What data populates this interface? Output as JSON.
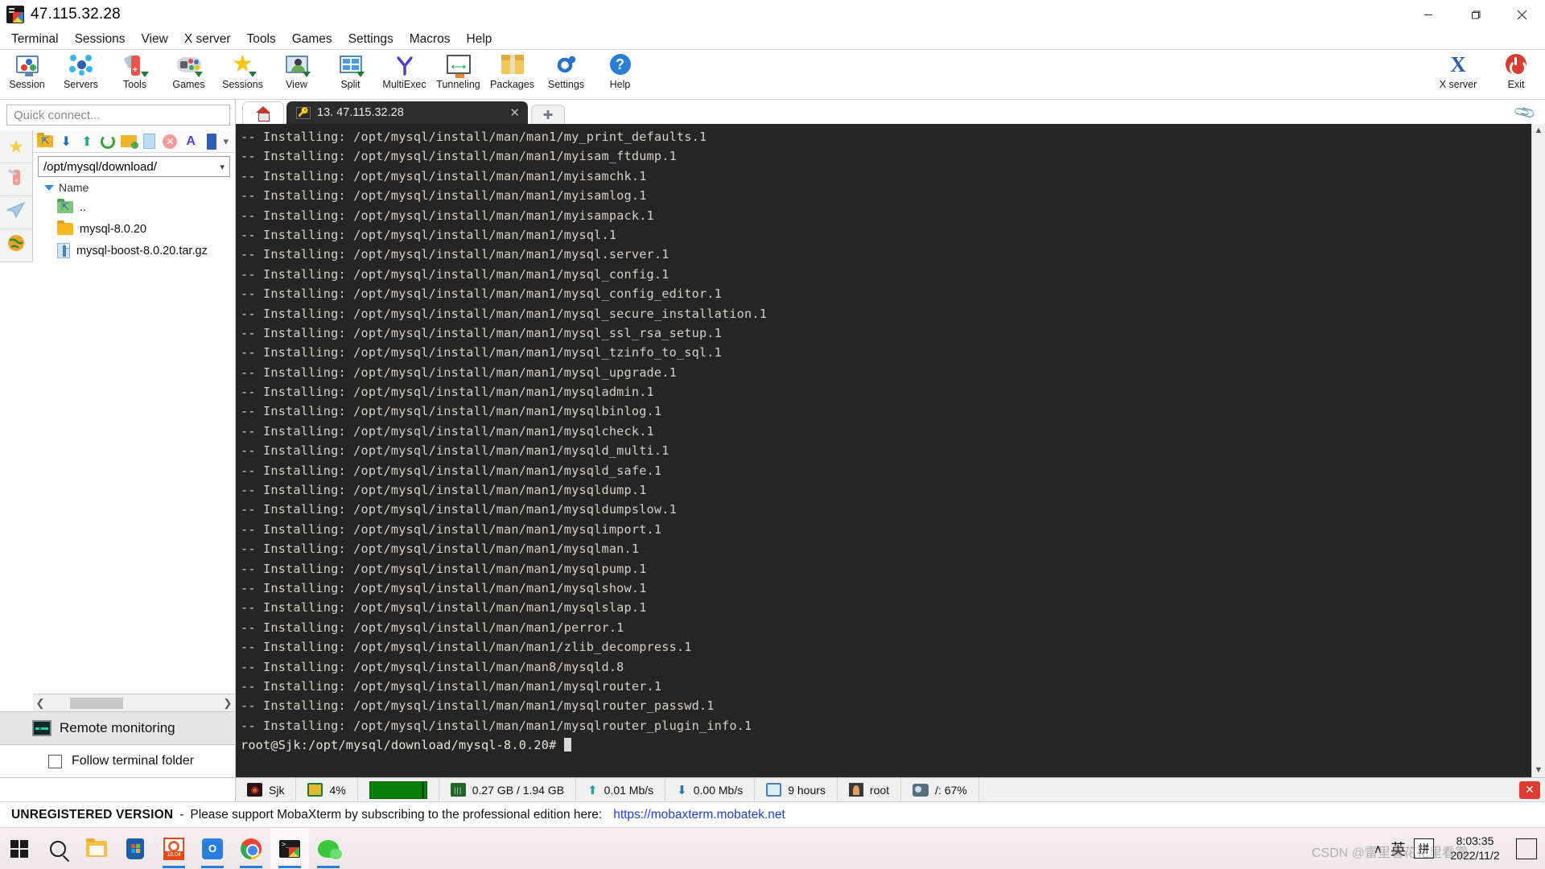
{
  "window": {
    "title": "47.115.32.28",
    "icon": "mobaxterm-logo-icon",
    "minimize": "─",
    "maximize": "❐",
    "close": "✕"
  },
  "menubar": {
    "items": [
      {
        "label": "Terminal"
      },
      {
        "label": "Sessions"
      },
      {
        "label": "View"
      },
      {
        "label": "X server"
      },
      {
        "label": "Tools"
      },
      {
        "label": "Games"
      },
      {
        "label": "Settings"
      },
      {
        "label": "Macros"
      },
      {
        "label": "Help"
      }
    ]
  },
  "toolbar": {
    "items": [
      {
        "label": "Session",
        "icon": "session-icon"
      },
      {
        "label": "Servers",
        "icon": "servers-icon"
      },
      {
        "label": "Tools",
        "icon": "tools-icon"
      },
      {
        "label": "Games",
        "icon": "games-icon"
      },
      {
        "label": "Sessions",
        "icon": "sessions-star-icon"
      },
      {
        "label": "View",
        "icon": "view-icon"
      },
      {
        "label": "Split",
        "icon": "split-icon"
      },
      {
        "label": "MultiExec",
        "icon": "multiexec-icon"
      },
      {
        "label": "Tunneling",
        "icon": "tunneling-icon"
      },
      {
        "label": "Packages",
        "icon": "packages-icon"
      },
      {
        "label": "Settings",
        "icon": "settings-gear-icon"
      },
      {
        "label": "Help",
        "icon": "help-icon"
      }
    ],
    "right_items": [
      {
        "label": "X server",
        "icon": "x-server-icon"
      },
      {
        "label": "Exit",
        "icon": "exit-power-icon"
      }
    ]
  },
  "sidebar": {
    "quick_connect_placeholder": "Quick connect...",
    "rail": [
      {
        "name": "bookmarks",
        "icon": "star-icon"
      },
      {
        "name": "tools",
        "icon": "swiss-knife-icon"
      },
      {
        "name": "sftp",
        "icon": "paper-plane-icon"
      },
      {
        "name": "macros",
        "icon": "globe-icon"
      }
    ],
    "browser_toolbar": [
      {
        "name": "parent-folder",
        "icon": "folder-up-icon"
      },
      {
        "name": "download",
        "icon": "download-arrow-icon"
      },
      {
        "name": "upload",
        "icon": "upload-arrow-icon"
      },
      {
        "name": "refresh",
        "icon": "refresh-icon"
      },
      {
        "name": "new-folder",
        "icon": "new-folder-icon"
      },
      {
        "name": "new-file",
        "icon": "new-file-icon"
      },
      {
        "name": "delete",
        "icon": "delete-x-icon"
      },
      {
        "name": "text-mode",
        "icon": "letter-a-icon"
      },
      {
        "name": "usb-mode",
        "icon": "usb-icon"
      }
    ],
    "path": "/opt/mysql/download/",
    "column_header": "Name",
    "files": [
      {
        "name": "..",
        "type": "parent-folder"
      },
      {
        "name": "mysql-8.0.20",
        "type": "folder"
      },
      {
        "name": "mysql-boost-8.0.20.tar.gz",
        "type": "file"
      }
    ],
    "remote_monitoring_label": "Remote monitoring",
    "follow_terminal_folder_label": "Follow terminal folder",
    "follow_terminal_folder_checked": false
  },
  "tabs": {
    "home_tab_icon": "home-icon",
    "active_tab_label": "13. 47.115.32.28",
    "active_tab_icon": "key-icon",
    "close_glyph": "✕",
    "add_tab_glyph": "➕",
    "clip_icon": "paperclip-icon"
  },
  "terminal": {
    "lines": [
      "-- Installing: /opt/mysql/install/man/man1/my_print_defaults.1",
      "-- Installing: /opt/mysql/install/man/man1/myisam_ftdump.1",
      "-- Installing: /opt/mysql/install/man/man1/myisamchk.1",
      "-- Installing: /opt/mysql/install/man/man1/myisamlog.1",
      "-- Installing: /opt/mysql/install/man/man1/myisampack.1",
      "-- Installing: /opt/mysql/install/man/man1/mysql.1",
      "-- Installing: /opt/mysql/install/man/man1/mysql.server.1",
      "-- Installing: /opt/mysql/install/man/man1/mysql_config.1",
      "-- Installing: /opt/mysql/install/man/man1/mysql_config_editor.1",
      "-- Installing: /opt/mysql/install/man/man1/mysql_secure_installation.1",
      "-- Installing: /opt/mysql/install/man/man1/mysql_ssl_rsa_setup.1",
      "-- Installing: /opt/mysql/install/man/man1/mysql_tzinfo_to_sql.1",
      "-- Installing: /opt/mysql/install/man/man1/mysql_upgrade.1",
      "-- Installing: /opt/mysql/install/man/man1/mysqladmin.1",
      "-- Installing: /opt/mysql/install/man/man1/mysqlbinlog.1",
      "-- Installing: /opt/mysql/install/man/man1/mysqlcheck.1",
      "-- Installing: /opt/mysql/install/man/man1/mysqld_multi.1",
      "-- Installing: /opt/mysql/install/man/man1/mysqld_safe.1",
      "-- Installing: /opt/mysql/install/man/man1/mysqldump.1",
      "-- Installing: /opt/mysql/install/man/man1/mysqldumpslow.1",
      "-- Installing: /opt/mysql/install/man/man1/mysqlimport.1",
      "-- Installing: /opt/mysql/install/man/man1/mysqlman.1",
      "-- Installing: /opt/mysql/install/man/man1/mysqlpump.1",
      "-- Installing: /opt/mysql/install/man/man1/mysqlshow.1",
      "-- Installing: /opt/mysql/install/man/man1/mysqlslap.1",
      "-- Installing: /opt/mysql/install/man/man1/perror.1",
      "-- Installing: /opt/mysql/install/man/man1/zlib_decompress.1",
      "-- Installing: /opt/mysql/install/man/man8/mysqld.8",
      "-- Installing: /opt/mysql/install/man/man1/mysqlrouter.1",
      "-- Installing: /opt/mysql/install/man/man1/mysqlrouter_passwd.1",
      "-- Installing: /opt/mysql/install/man/man1/mysqlrouter_plugin_info.1"
    ],
    "prompt": "root@Sjk:/opt/mysql/download/mysql-8.0.20# ",
    "bg_color": "#252525",
    "fg_color": "#d6d0c8"
  },
  "statusbar": {
    "cells": [
      {
        "icon": "ubuntu-icon",
        "label": "Sjk"
      },
      {
        "icon": "cpu-icon",
        "label": "4%"
      },
      {
        "icon": "memory-gauge",
        "label": ""
      },
      {
        "icon": "ram-icon",
        "label": "0.27 GB / 1.94 GB"
      },
      {
        "icon": "upload-icon",
        "label": "0.01 Mb/s"
      },
      {
        "icon": "download-icon",
        "label": "0.00 Mb/s"
      },
      {
        "icon": "clock-icon",
        "label": "9 hours"
      },
      {
        "icon": "user-icon",
        "label": "root"
      },
      {
        "icon": "disk-icon",
        "label": "/: 67%"
      }
    ],
    "close_glyph": "✕"
  },
  "banner": {
    "bold_text": "UNREGISTERED VERSION",
    "dash": "-",
    "message": "Please support MobaXterm by subscribing to the professional edition here:",
    "link": "https://mobaxterm.mobatek.net",
    "link_color": "#1f3fd6"
  },
  "taskbar": {
    "items": [
      {
        "name": "start-button",
        "icon": "windows-logo-icon"
      },
      {
        "name": "search",
        "icon": "search-icon"
      },
      {
        "name": "file-explorer",
        "icon": "folder-icon"
      },
      {
        "name": "microsoft-store",
        "icon": "store-icon"
      },
      {
        "name": "ubuntu-1804",
        "icon": "ubuntu-icon",
        "badge": "18.04"
      },
      {
        "name": "outlook",
        "icon": "outlook-icon"
      },
      {
        "name": "google-chrome",
        "icon": "chrome-icon"
      },
      {
        "name": "mobaxterm",
        "icon": "mobaxterm-icon"
      },
      {
        "name": "wechat",
        "icon": "wechat-icon"
      }
    ],
    "tray": {
      "chevron": "∧",
      "ime_lang": "英",
      "ime_mode": "拼",
      "time": "8:03:35",
      "date": "2022/11/2"
    },
    "watermark": "CSDN @雷里看花花里看雾"
  }
}
